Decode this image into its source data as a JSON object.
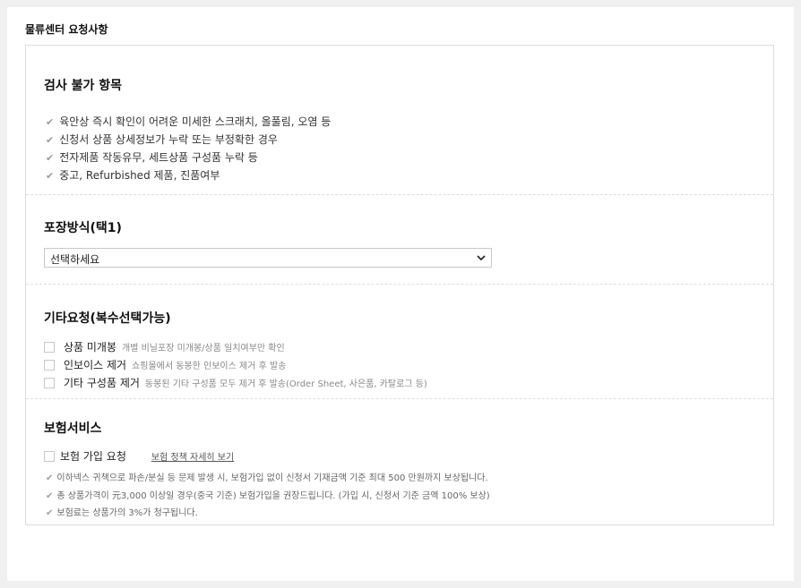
{
  "page_title": "물류센터 요청사항",
  "inspection": {
    "title": "검사 불가 항목",
    "items": [
      "육안상 즉시 확인이 어려운 미세한 스크래치, 올풀림, 오염 등",
      "신청서 상품 상세정보가 누락 또는 부정확한 경우",
      "전자제품 작동유무, 세트상품 구성품 누락 등",
      "중고, Refurbished 제품, 진품여부"
    ]
  },
  "packing": {
    "title": "포장방식(택1)",
    "select_value": "선택하세요"
  },
  "other": {
    "title": "기타요청(복수선택가능)",
    "options": [
      {
        "label": "상품 미개봉",
        "desc": "개별 비닐포장 미개봉/상품 일치여부만 확인"
      },
      {
        "label": "인보이스 제거",
        "desc": "쇼핑몰에서 동봉한 인보이스 제거 후 발송"
      },
      {
        "label": "기타 구성품 제거",
        "desc": "동봉된 기타 구성품 모두 제거 후 발송(Order Sheet, 사은품, 카탈로그 등)"
      }
    ]
  },
  "insurance": {
    "title": "보험서비스",
    "option_label": "보험 가입 요청",
    "policy_link": "보험 정책 자세히 보기",
    "notes": [
      "이하넥스 귀책으로 파손/분실 등 문제 발생 시, 보험가입 없이 신청서 기재금액 기준 최대 500 만원까지 보상됩니다.",
      "총 상품가격이 元3,000 이상일 경우(중국 기준) 보험가입을 권장드립니다. (가입 시, 신청서 기준 금액 100% 보상)",
      "보험료는 상품가의 3%가 청구됩니다."
    ]
  }
}
